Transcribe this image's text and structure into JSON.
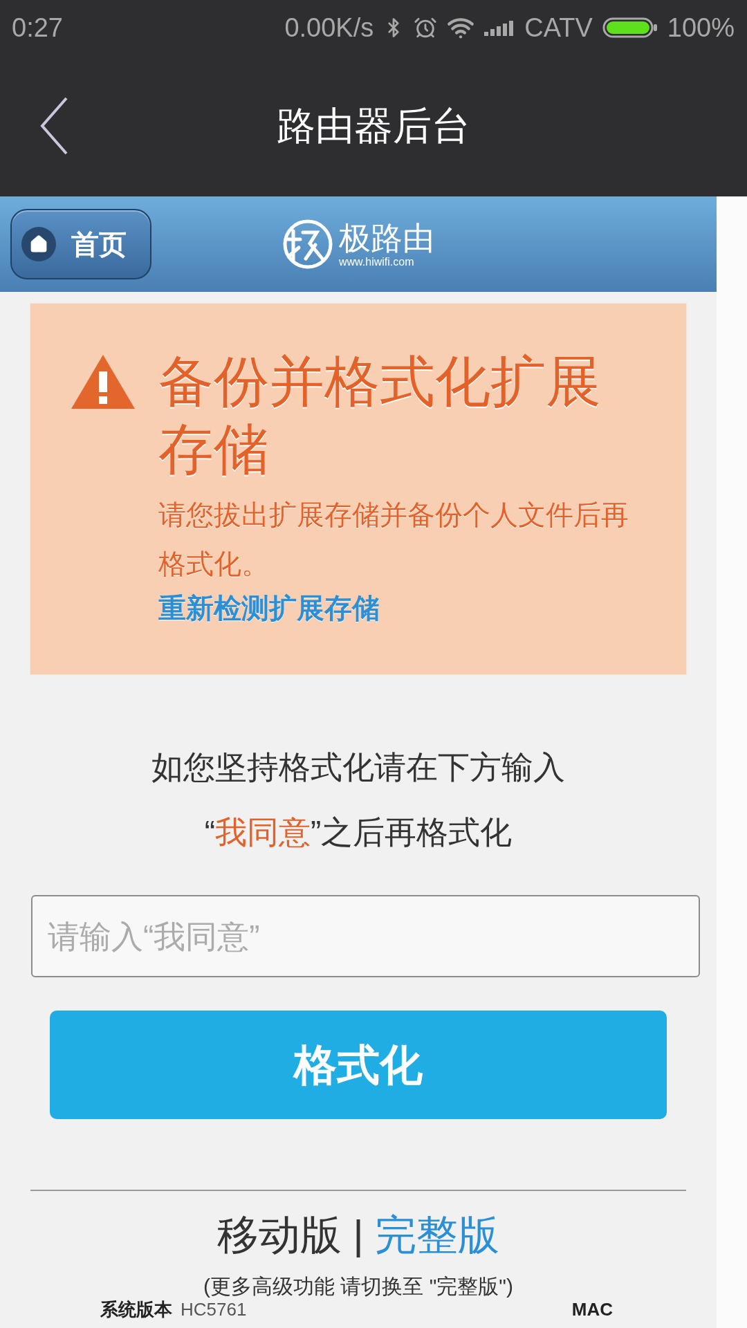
{
  "status_bar": {
    "time": "0:27",
    "net_speed": "0.00K/s",
    "carrier": "CATV",
    "battery": "100%"
  },
  "app_bar": {
    "title": "路由器后台"
  },
  "site_header": {
    "home_button": "首页",
    "logo_text": "极路由",
    "logo_url": "www.hiwifi.com"
  },
  "warning": {
    "title": "备份并格式化扩展存储",
    "message": "请您拔出扩展存储并备份个人文件后再格式化。",
    "link": "重新检测扩展存储"
  },
  "instruction": "如您坚持格式化请在下方输入",
  "confirm_line": [
    {
      "kind": "plain",
      "text": "“"
    },
    {
      "kind": "highlight",
      "text": "我同意"
    },
    {
      "kind": "plain",
      "text": "”之后再格式化"
    }
  ],
  "confirm_input": {
    "placeholder": "请输入“我同意”"
  },
  "format_button": "格式化",
  "footer": {
    "versions": [
      {
        "label": "移动版",
        "selected": true
      },
      {
        "label": "完整版",
        "selected": false
      }
    ],
    "separator": "|",
    "note": "(更多高级功能 请切换至 \"完整版\")",
    "system_info": [
      {
        "kind": "label",
        "text": "系统版本"
      },
      {
        "kind": "value",
        "text": "HC5761"
      },
      {
        "kind": "label",
        "text": "MAC"
      }
    ]
  }
}
